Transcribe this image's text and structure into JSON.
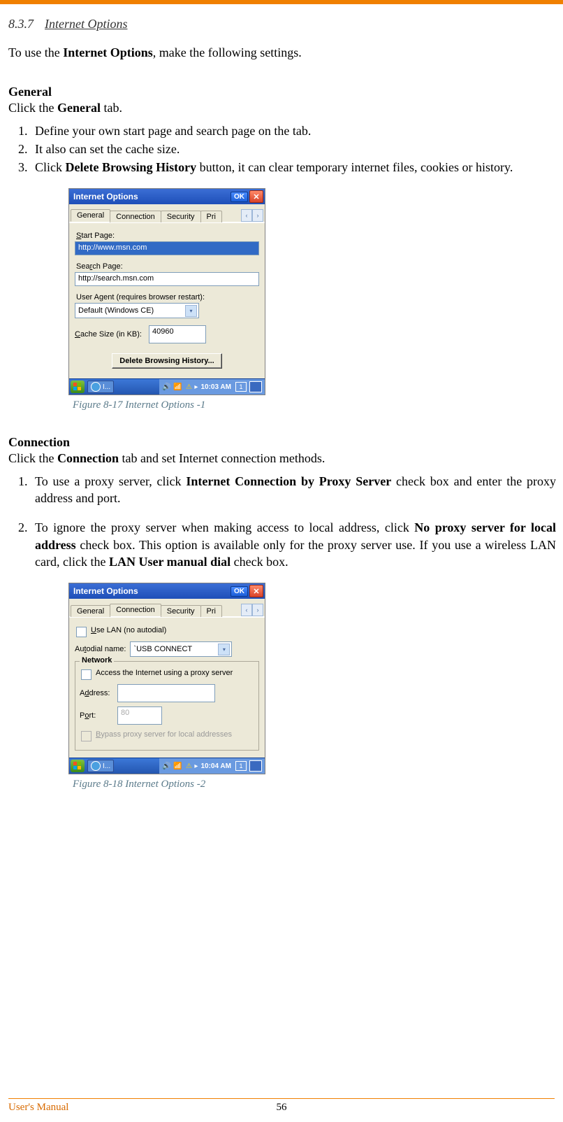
{
  "page": {
    "section_number": "8.3.7",
    "section_title": "Internet Options",
    "intro_pre": "To use the ",
    "intro_bold": "Internet Options",
    "intro_post": ", make the following settings.",
    "general_heading": "General",
    "general_line_pre": "Click the ",
    "general_line_bold": "General",
    "general_line_post": "  tab.",
    "general_list": {
      "i1": "Define your own start page and search page on the tab.",
      "i2": "It also can set the cache size.",
      "i3_pre": "Click  ",
      "i3_bold": "Delete Browsing History",
      "i3_post": " button, it can clear temporary internet files, cookies or history."
    },
    "connection_heading": "Connection",
    "connection_line_pre": "Click the ",
    "connection_line_bold": "Connection",
    "connection_line_post": " tab and set Internet connection methods.",
    "connection_list": {
      "i1_pre": "To use a proxy server, click ",
      "i1_bold": "Internet Connection by Proxy Server",
      "i1_post": " check box and enter the proxy address and port.",
      "i2_a_pre": "To ignore the proxy server when making access to local address, click ",
      "i2_a_bold": "No proxy server for local address",
      "i2_a_post": " check box. This option is available only for the proxy server use. If you use a wireless LAN card, click the ",
      "i2_b_bold": "LAN User manual dial",
      "i2_b_post": " check box."
    },
    "footer_left": "User's Manual",
    "footer_page": "56"
  },
  "dialog1": {
    "title": "Internet Options",
    "ok": "OK",
    "tabs": {
      "t1": "General",
      "t2": "Connection",
      "t3": "Security",
      "t4": "Pri"
    },
    "start_label": "Start Page:",
    "start_value": "http://www.msn.com",
    "search_label": "Search Page:",
    "search_value": "http://search.msn.com",
    "ua_label": "User Agent (requires browser restart):",
    "ua_value": "Default (Windows CE)",
    "cache_label": "Cache Size (in KB):",
    "cache_value": "40960",
    "del_button": "Delete Browsing History...",
    "task_label": "I...",
    "time": "10:03 AM",
    "kb": "1",
    "caption": "Figure 8-17 Internet Options -1"
  },
  "dialog2": {
    "title": "Internet Options",
    "ok": "OK",
    "tabs": {
      "t1": "General",
      "t2": "Connection",
      "t3": "Security",
      "t4": "Pri"
    },
    "use_lan": "Use LAN (no autodial)",
    "autodial_label": "Autodial name:",
    "autodial_value": "`USB CONNECT",
    "network_legend": "Network",
    "proxy_chk": "Access the Internet using a proxy server",
    "addr_label": "Address:",
    "port_label": "Port:",
    "port_value": "80",
    "bypass_chk": "Bypass proxy server for local addresses",
    "task_label": "I...",
    "time": "10:04 AM",
    "kb": "1",
    "caption": "Figure 8-18 Internet Options -2"
  }
}
